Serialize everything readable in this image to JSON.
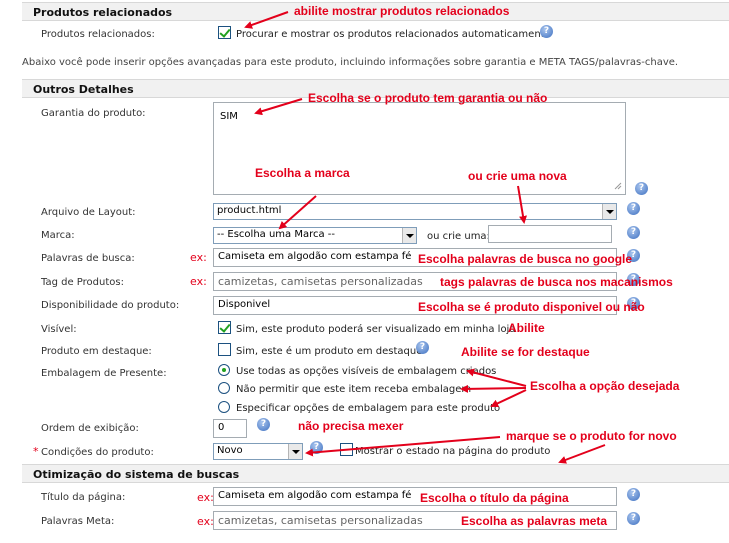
{
  "sections": {
    "related": "Produtos relacionados",
    "details": "Outros Detalhes",
    "seo": "Otimização do sistema de buscas"
  },
  "related": {
    "label": "Produtos relacionados:",
    "checkbox_text": "Procurar e mostrar os produtos relacionados automaticamente",
    "checked": true
  },
  "info_note": "Abaixo você pode inserir opções avançadas para este produto, incluindo informações sobre garantia e META TAGS/palavras-chave.",
  "fields": {
    "warranty": {
      "label": "Garantia do produto:",
      "value": "SIM"
    },
    "layout": {
      "label": "Arquivo de Layout:",
      "value": "product.html"
    },
    "brand": {
      "label": "Marca:",
      "value": "-- Escolha uma Marca --",
      "or_create": "ou crie uma:",
      "new_value": ""
    },
    "search_words": {
      "label": "Palavras de busca:",
      "value": "Camiseta em algodão com estampa fé"
    },
    "tags": {
      "label": "Tag de Produtos:",
      "value": "camizetas, camisetas personalizadas"
    },
    "availability": {
      "label": "Disponibilidade do produto:",
      "value": "Disponivel"
    },
    "visible": {
      "label": "Visível:",
      "text": "Sim, este produto poderá ser visualizado em minha loja",
      "checked": true
    },
    "featured": {
      "label": "Produto em destaque:",
      "text": "Sim, este é um produto em destaque",
      "checked": false
    },
    "gift_wrap": {
      "label": "Embalagem de Presente:",
      "options": [
        "Use todas as opções visíveis de embalagem criados",
        "Não permitir que este item receba embalagem",
        "Especificar opções de embalagem para este produto"
      ],
      "selected": 0
    },
    "sort_order": {
      "label": "Ordem de exibição:",
      "value": "0"
    },
    "condition": {
      "required_mark": "*",
      "label": "Condições do produto:",
      "value": "Novo",
      "show_text": "Mostrar o estado na página do produto",
      "show_checked": false
    },
    "page_title": {
      "label": "Título da página:",
      "value": "Camiseta em algodão com estampa fé"
    },
    "meta_words": {
      "label": "Palavras Meta:",
      "value": "camizetas, camisetas personalizadas"
    }
  },
  "ex_label": "ex:",
  "help_glyph": "?",
  "annotations": {
    "related": "abilite mostrar produtos relacionados",
    "warranty": "Escolha se o produto tem garantia ou não",
    "brand": "Escolha a marca",
    "new_brand": "ou crie uma nova",
    "search": "Escolha palavras de busca no google",
    "tags": "tags palavras de busca nos macanismos",
    "availability": "Escolha se é produto disponivel ou não",
    "visible": "Abilite",
    "featured": "Abilite se for destaque",
    "gift": "Escolha a opção desejada",
    "sort": "não precisa mexer",
    "condition": "marque se o produto for novo",
    "title": "Escolha o título da página",
    "meta": "Escolha as palavras meta"
  },
  "colors": {
    "annotation": "#e3001b",
    "section_bg": "#f1f1f1",
    "check": "#21a121"
  }
}
